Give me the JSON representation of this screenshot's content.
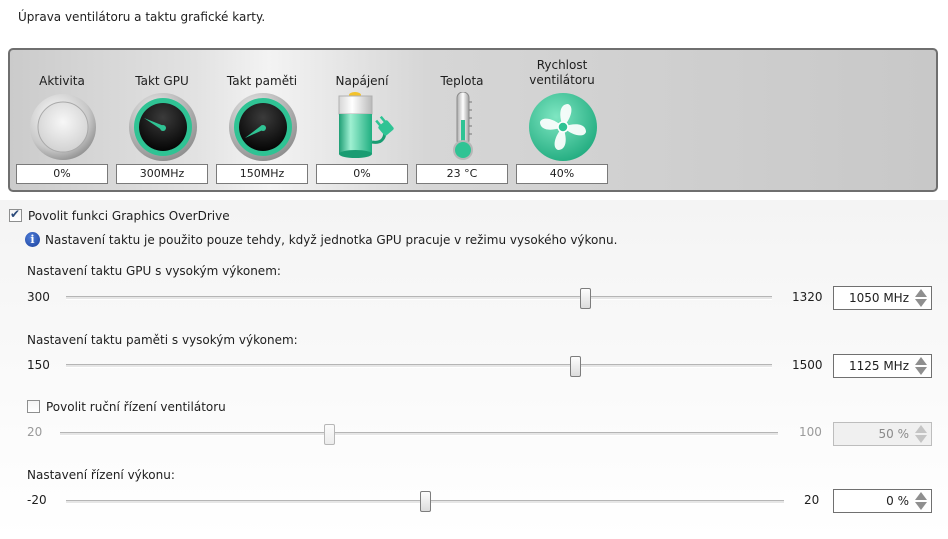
{
  "page": {
    "title": "Úprava ventilátoru a taktu grafické karty."
  },
  "status": {
    "activity": {
      "label": "Aktivita",
      "value": "0%",
      "level": 0
    },
    "gpu_clock": {
      "label": "Takt GPU",
      "value": "300MHz"
    },
    "mem_clock": {
      "label": "Takt paměti",
      "value": "150MHz"
    },
    "power": {
      "label": "Napájení",
      "value": "0%"
    },
    "temperature": {
      "label": "Teplota",
      "value": "23  °C"
    },
    "fan": {
      "label_line1": "Rychlost",
      "label_line2": "ventilátoru",
      "value": "40%"
    }
  },
  "overdrive": {
    "enable_label": "Povolit funkci Graphics OverDrive",
    "enabled": true,
    "info_text": "Nastavení taktu je použito pouze tehdy, když jednotka GPU pracuje v režimu vysokého výkonu."
  },
  "gpu_slider": {
    "label": "Nastavení taktu GPU s vysokým výkonem:",
    "min": "300",
    "max": "1320",
    "value_text": "1050  MHz",
    "value": 1050,
    "min_num": 300,
    "max_num": 1320
  },
  "mem_slider": {
    "label": "Nastavení taktu paměti s vysokým výkonem:",
    "min": "150",
    "max": "1500",
    "value_text": "1125  MHz",
    "value": 1125,
    "min_num": 150,
    "max_num": 1500
  },
  "fan_control": {
    "enable_label": "Povolit ruční řízení ventilátoru",
    "enabled": false,
    "min": "20",
    "max": "100",
    "value_text": "50  %",
    "value": 50,
    "min_num": 20,
    "max_num": 100
  },
  "power_slider": {
    "label": "Nastavení řízení výkonu:",
    "min": "-20",
    "max": "20",
    "value_text": "0  %",
    "value": 0,
    "min_num": -20,
    "max_num": 20
  },
  "colors": {
    "accent_green": "#2fc394",
    "panel_border": "#6f6f6f"
  }
}
